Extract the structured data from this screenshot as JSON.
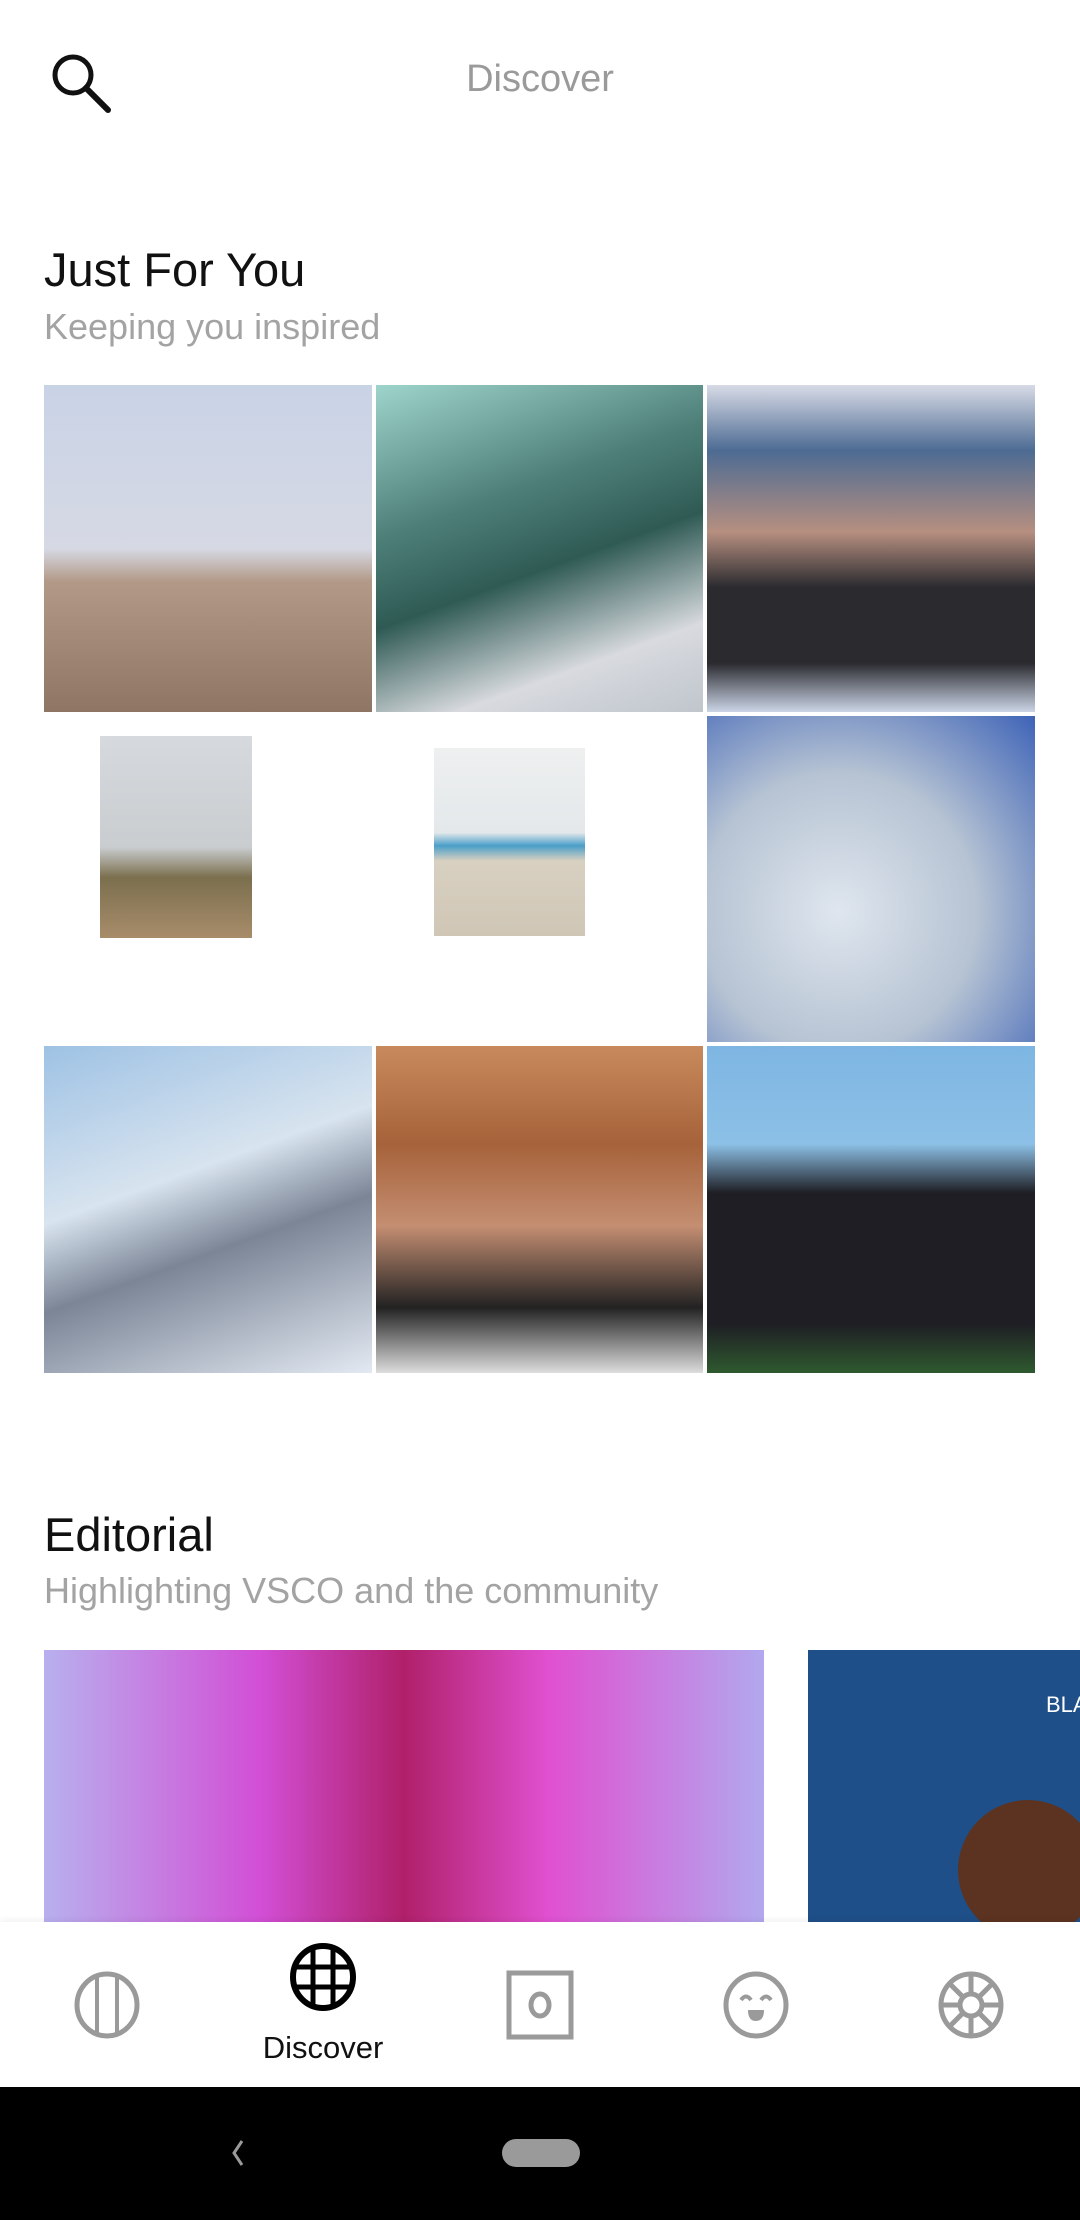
{
  "header": {
    "title": "Discover",
    "search_icon": "search-icon"
  },
  "just_for_you": {
    "title": "Just For You",
    "subtitle": "Keeping you inspired",
    "images": [
      "backflip on sand dune",
      "skateboarder double exposure",
      "man in cap with star mask",
      "framed tree on rocks",
      "framed beach boardwalk",
      "water bags with blue ties",
      "billboard against sky",
      "portrait with freckles",
      "person with red hat on head"
    ]
  },
  "editorial": {
    "title": "Editorial",
    "subtitle": "Highlighting VSCO and the community",
    "cards": [
      {
        "image": "face with jewels purple"
      },
      {
        "image": "raised fist blue",
        "text": "BLA"
      }
    ]
  },
  "bottom_nav": {
    "items": [
      {
        "icon": "studio-icon"
      },
      {
        "icon": "globe-icon",
        "label": "Discover",
        "active": true
      },
      {
        "icon": "camera-icon"
      },
      {
        "icon": "smiley-icon"
      },
      {
        "icon": "settings-wheel-icon"
      }
    ],
    "active_color": "#000000",
    "inactive_color": "#9a9a9a"
  },
  "system_nav": {
    "back_icon": "back-icon",
    "home_icon": "home-pill-icon"
  }
}
